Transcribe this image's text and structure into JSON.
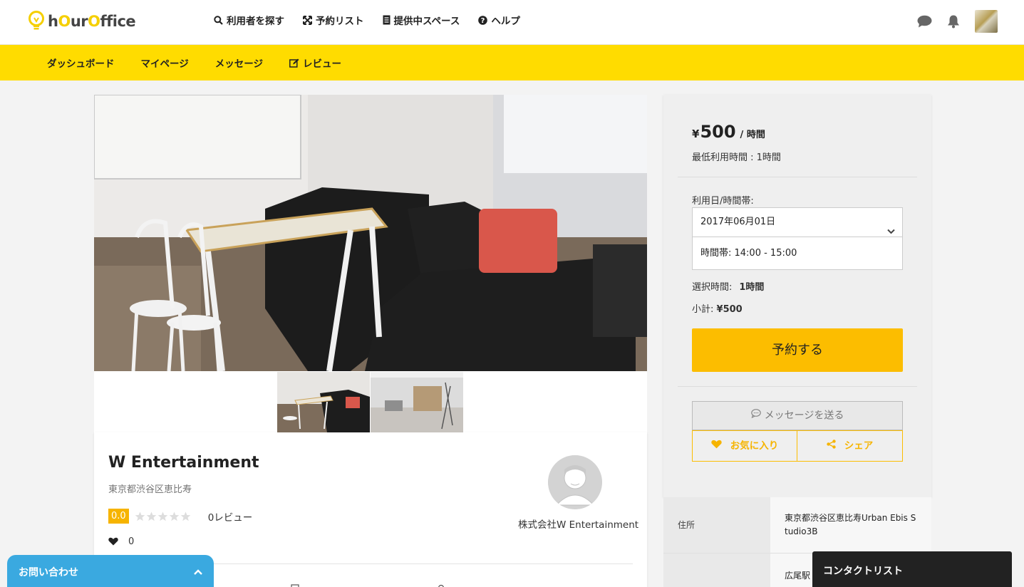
{
  "header": {
    "logo_text_a": "h",
    "logo_text_b": "O",
    "logo_text_c": "ur",
    "logo_text_d": "O",
    "logo_text_e": "ffice",
    "nav": [
      {
        "label": "利用者を探す",
        "icon": "search-icon"
      },
      {
        "label": "予約リスト",
        "icon": "expand-icon"
      },
      {
        "label": "提供中スペース",
        "icon": "document-icon"
      },
      {
        "label": "ヘルプ",
        "icon": "question-circle-icon"
      }
    ],
    "right_icons": [
      "chat-icon",
      "bell-icon"
    ]
  },
  "subnav": {
    "items": [
      {
        "label": "ダッシュボード"
      },
      {
        "label": "マイページ"
      },
      {
        "label": "メッセージ"
      },
      {
        "label": "レビュー",
        "icon": "edit-icon"
      }
    ]
  },
  "space": {
    "title": "W Entertainment",
    "address": "東京都渋谷区恵比寿",
    "rating": "0.0",
    "stars_filled": 0,
    "stars_total": 5,
    "reviews": "0レビュー",
    "favorites": "0",
    "owner_name": "株式会社W Entertainment"
  },
  "booking": {
    "price_currency": "¥",
    "price_amount": "500",
    "price_unit": "/ 時間",
    "min_time": "最低利用時間 : 1時間",
    "date_label": "利用日/時間帯:",
    "date_value": "2017年06月01日",
    "time_value": "時間帯: 14:00 - 15:00",
    "selected_label": "選択時間:",
    "selected_value": "1時間",
    "subtotal_label": "小計:",
    "subtotal_value": "¥500",
    "reserve_label": "予約する",
    "message_label": "メッセージを送る",
    "favorite_label": "お気に入り",
    "share_label": "シェア"
  },
  "details": {
    "rows": [
      {
        "label": "住所",
        "value": "東京都渋谷区恵比寿Urban Ebis Studio3B"
      },
      {
        "label": "",
        "value": "広尾駅"
      }
    ]
  },
  "widgets": {
    "contact_label": "お問い合わせ",
    "contact_list_label": "コンタクトリスト"
  },
  "colors": {
    "brand_yellow": "#ffdc00",
    "accent_orange": "#fcbd00",
    "contact_blue": "#3aa9e0"
  }
}
